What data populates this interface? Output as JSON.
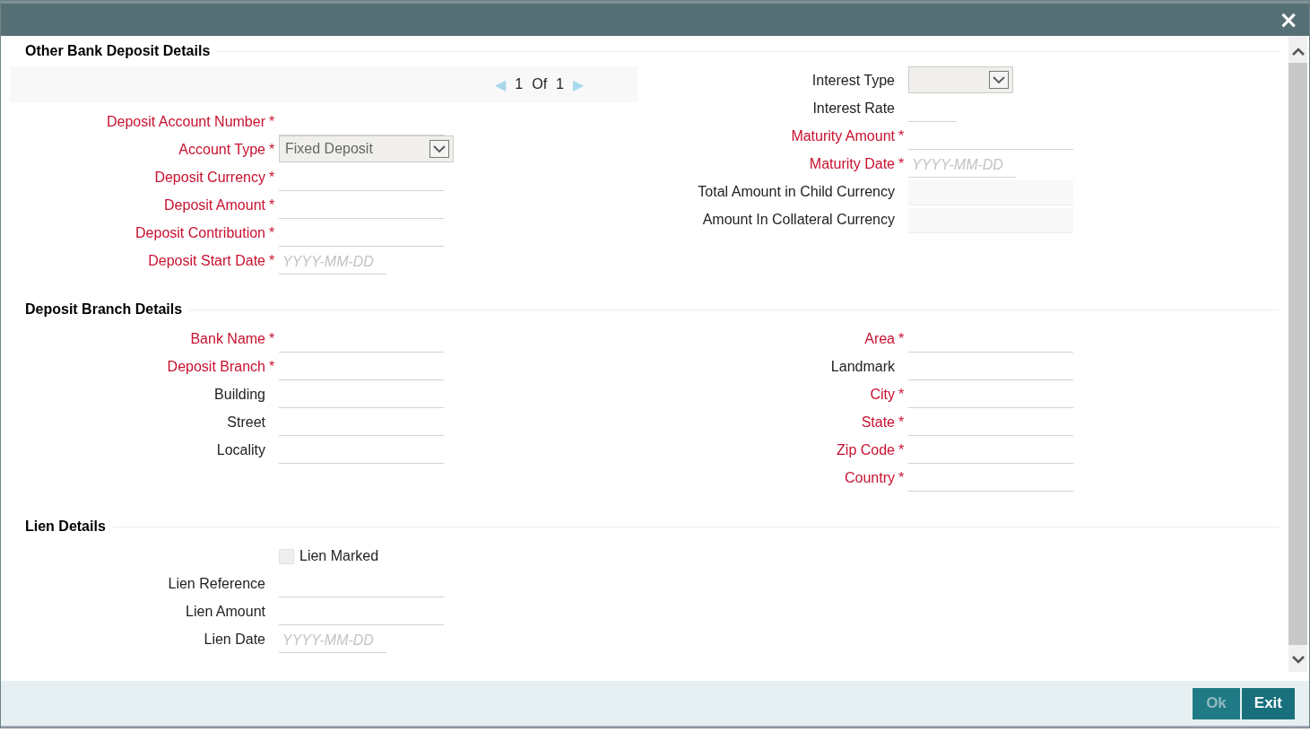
{
  "window": {
    "close": "×"
  },
  "sections": [
    {
      "title": "Other Bank Deposit Details",
      "pager": {
        "prev": "◀",
        "current": "1",
        "of": "Of",
        "total": "1",
        "next": "▶"
      },
      "left": [
        {
          "label": "Deposit Account Number",
          "required_mark": "*",
          "kind": "text"
        },
        {
          "label": "Account Type",
          "required_mark": "*",
          "kind": "select",
          "value": "Fixed Deposit"
        },
        {
          "label": "Deposit Currency",
          "required_mark": "*",
          "kind": "text"
        },
        {
          "label": "Deposit Amount",
          "required_mark": "*",
          "kind": "text"
        },
        {
          "label": "Deposit Contribution",
          "required_mark": "*",
          "kind": "text"
        },
        {
          "label": "Deposit Start Date",
          "required_mark": "*",
          "kind": "date",
          "placeholder": "YYYY-MM-DD"
        }
      ],
      "right": [
        {
          "label": "Interest Type",
          "kind": "select"
        },
        {
          "label": "Interest Rate",
          "kind": "short"
        },
        {
          "label": "Maturity Amount",
          "required_mark": "*",
          "kind": "text"
        },
        {
          "label": "Maturity Date",
          "required_mark": "*",
          "kind": "date",
          "placeholder": "YYYY-MM-DD"
        },
        {
          "label": "Total Amount in Child Currency",
          "kind": "readonly"
        },
        {
          "label": "Amount In Collateral Currency",
          "kind": "readonly"
        }
      ]
    },
    {
      "title": "Deposit Branch Details",
      "left": [
        {
          "label": "Bank Name",
          "required_mark": "*",
          "kind": "text"
        },
        {
          "label": "Deposit Branch",
          "required_mark": "*",
          "kind": "text"
        },
        {
          "label": "Building",
          "kind": "text"
        },
        {
          "label": "Street",
          "kind": "text"
        },
        {
          "label": "Locality",
          "kind": "text"
        }
      ],
      "right": [
        {
          "label": "Area",
          "required_mark": "*",
          "kind": "text"
        },
        {
          "label": "Landmark",
          "kind": "text"
        },
        {
          "label": "City",
          "required_mark": "*",
          "kind": "text"
        },
        {
          "label": "State",
          "required_mark": "*",
          "kind": "text"
        },
        {
          "label": "Zip Code",
          "required_mark": "*",
          "kind": "text"
        },
        {
          "label": "Country",
          "required_mark": "*",
          "kind": "text"
        }
      ]
    },
    {
      "title": "Lien Details",
      "left": [
        {
          "label": "Lien Marked",
          "kind": "checkbox",
          "checked": false
        },
        {
          "label": "Lien Reference",
          "kind": "text"
        },
        {
          "label": "Lien Amount",
          "kind": "text"
        },
        {
          "label": "Lien Date",
          "kind": "date",
          "placeholder": "YYYY-MM-DD"
        }
      ]
    }
  ],
  "buttons": [
    {
      "label": "Ok",
      "disabled": true
    },
    {
      "label": "Exit",
      "disabled": false
    }
  ]
}
